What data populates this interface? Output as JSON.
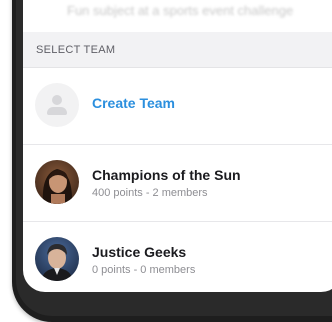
{
  "header": {
    "faded_caption": "Fun subject at a sports event challenge"
  },
  "section": {
    "title": "SELECT TEAM"
  },
  "create_team": {
    "label": "Create Team"
  },
  "teams": [
    {
      "name": "Champions of the Sun",
      "meta": "400 points - 2 members"
    },
    {
      "name": "Justice Geeks",
      "meta": "0 points - 0 members"
    }
  ],
  "colors": {
    "accent": "#2b8fde",
    "header_bg": "#f2f2f4",
    "phone_frame": "#1e1e1e"
  }
}
